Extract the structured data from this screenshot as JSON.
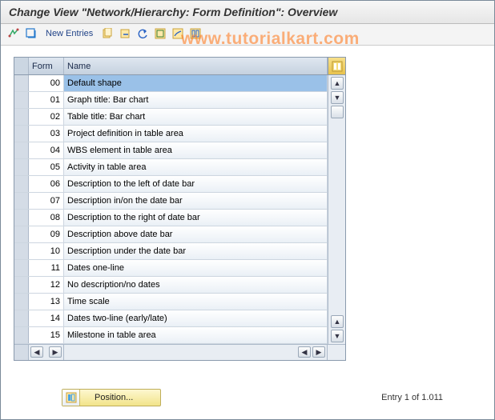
{
  "title": "Change View \"Network/Hierarchy: Form Definition\": Overview",
  "watermark": "www.tutorialkart.com",
  "toolbar": {
    "new_entries": "New Entries"
  },
  "columns": {
    "form": "Form",
    "name": "Name"
  },
  "rows": [
    {
      "form": "00",
      "name": "Default shape",
      "selected": true
    },
    {
      "form": "01",
      "name": "Graph title: Bar chart"
    },
    {
      "form": "02",
      "name": "Table title: Bar chart"
    },
    {
      "form": "03",
      "name": "Project definition in table area"
    },
    {
      "form": "04",
      "name": "WBS element in table area"
    },
    {
      "form": "05",
      "name": "Activity in table area"
    },
    {
      "form": "06",
      "name": "Description to the left of date bar"
    },
    {
      "form": "07",
      "name": "Description in/on the date bar"
    },
    {
      "form": "08",
      "name": "Description to the right of date bar"
    },
    {
      "form": "09",
      "name": "Description above date bar"
    },
    {
      "form": "10",
      "name": "Description under the date bar"
    },
    {
      "form": "11",
      "name": "Dates one-line"
    },
    {
      "form": "12",
      "name": "No description/no dates"
    },
    {
      "form": "13",
      "name": "Time scale"
    },
    {
      "form": "14",
      "name": "Dates two-line (early/late)"
    },
    {
      "form": "15",
      "name": "Milestone in table area"
    }
  ],
  "footer": {
    "position_label": "Position...",
    "entry_text": "Entry 1 of 1.011"
  }
}
